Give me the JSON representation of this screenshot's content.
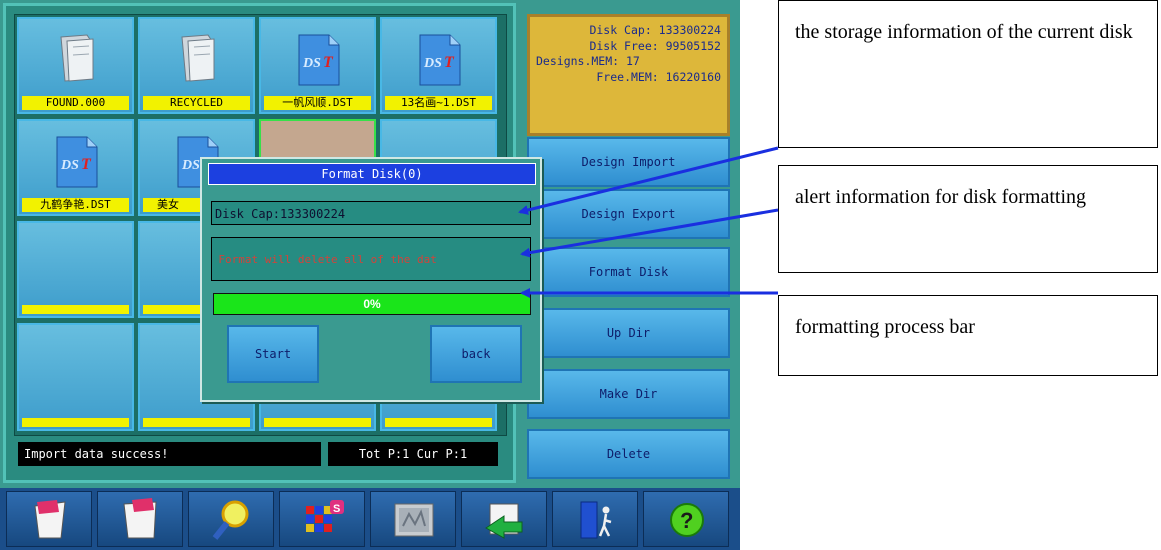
{
  "files": [
    {
      "name": "FOUND.000",
      "icon": "folder-icon"
    },
    {
      "name": "RECYCLED",
      "icon": "folder-icon"
    },
    {
      "name": "一帆风顺.DST",
      "icon": "dst-file-icon"
    },
    {
      "name": "13名画~1.DST",
      "icon": "dst-file-icon"
    },
    {
      "name": "九鹤争艳.DST",
      "icon": "dst-file-icon"
    },
    {
      "name": "美女",
      "icon": "dst-file-icon"
    }
  ],
  "status": {
    "message": "Import data success!",
    "pages": "Tot P:1 Cur P:1"
  },
  "disk_info": {
    "cap": "Disk Cap: 133300224",
    "free": "Disk Free: 99505152",
    "designs_mem": "Designs.MEM: 17",
    "free_mem": "Free.MEM: 16220160"
  },
  "side_buttons": [
    "Design Import",
    "Design Export",
    "Format Disk",
    "Up Dir",
    "Make Dir",
    "Delete"
  ],
  "toolbar": [
    "open-file-icon",
    "save-file-icon",
    "magnifier-icon",
    "color-grid-icon",
    "stitch-pattern-icon",
    "transfer-icon",
    "exit-door-icon",
    "help-icon"
  ],
  "dialog": {
    "title": "Format Disk(0)",
    "disk_cap": "Disk Cap:133300224",
    "warning": "rning: Format will delete all of the dat",
    "progress_percent": 0,
    "progress_label": "0%",
    "start_label": "Start",
    "back_label": "back"
  },
  "annotations": [
    "the storage information of the current disk",
    "alert information for disk formatting",
    "formatting process bar"
  ],
  "colors": {
    "accent_arrow": "#1a2fe0",
    "label_yellow": "#f2f200",
    "progress_green": "#1ae51a",
    "title_blue": "#1c40e0"
  }
}
